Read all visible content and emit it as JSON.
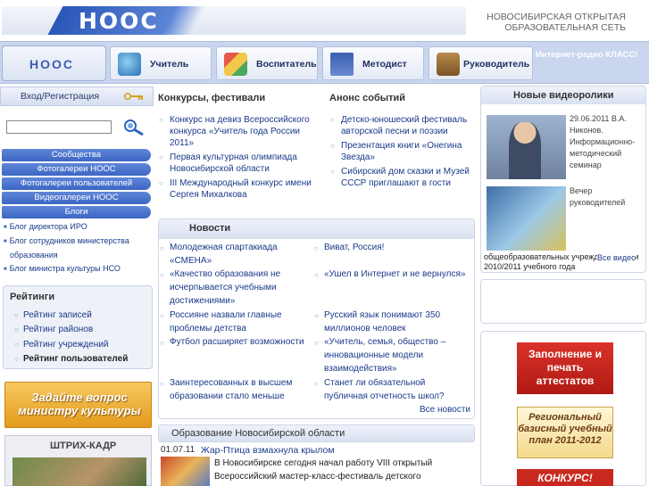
{
  "header": {
    "logo": "НООС",
    "network_name_line1": "НОВОСИБИРСКАЯ ОТКРЫТАЯ",
    "network_name_line2": "ОБРАЗОВАТЕЛЬНАЯ СЕТЬ"
  },
  "topnav": {
    "home": "НООС",
    "items": [
      {
        "label": "Учитель",
        "icon": "globe-icon"
      },
      {
        "label": "Воспитатель",
        "icon": "abc-blocks-icon"
      },
      {
        "label": "Методист",
        "icon": "book-icon"
      },
      {
        "label": "Руководитель",
        "icon": "briefcase-icon"
      }
    ],
    "radio": "Интернет-радио КЛАСС!"
  },
  "sidebar": {
    "login": "Вход/Регистрация",
    "menu": [
      "Сообщества",
      "Фотогалереи НООС",
      "Фотогалереи пользователей",
      "Видеогалереи НООС",
      "Блоги"
    ],
    "blogs": [
      "Блог директора ИРО",
      "Блог сотрудников министерства",
      "образования",
      "Блог министра культуры НСО"
    ],
    "ratings_title": "Рейтинги",
    "ratings": [
      "Рейтинг записей",
      "Рейтинг районов",
      "Рейтинг учреждений",
      "Рейтинг пользователей"
    ],
    "minister_banner": "Задайте вопрос министру культуры",
    "strih_title": "ШТРИХ-КАДР"
  },
  "contests": {
    "title": "Конкурсы, фестивали",
    "items": [
      "Конкурс на девиз Всероссийского конкурса «Учитель года России 2011»",
      "Первая культурная олимпиада Новосибирской области",
      "III Международный конкурс имени Сергея Михалкова"
    ]
  },
  "events": {
    "title": "Анонс событий",
    "items": [
      "Детско-юношеский фестиваль авторской песни и поэзии",
      "Презентация книги «Онегина Звезда»",
      "Сибирский дом сказки и Музей СССР приглашают в гости"
    ]
  },
  "news": {
    "title": "Новости",
    "left": [
      "Молодежная спартакиада «СМЕНА»",
      "«Качество образования не исчерпывается учебными достижениями»",
      "Россияне назвали главные проблемы детства",
      "Футбол расширяет возможности",
      "Заинтересованных в высшем образовании стало меньше"
    ],
    "right": [
      "Виват, Россия!",
      "«Ушел в Интернет и не вернулся»",
      "Русский язык понимают 350 миллионов человек",
      "«Учитель, семья, общество – инновационные модели взаимодействия»",
      "Станет ли обязательной публичная отчетность школ?"
    ],
    "all": "Все новости"
  },
  "education": {
    "title": "Образование Новосибирской области",
    "date": "01.07.11",
    "headline": "Жар-Птица взмахнула крылом",
    "text": "В Новосибирске сегодня начал работу VIII открытый Всероссийский мастер-класс-фестиваль детского"
  },
  "videos": {
    "title": "Новые видеоролики",
    "v1": "29.06.2011 В.А. Никонов. Информационно-методический семинар",
    "v2": "Вечер руководителей",
    "v2_sub": "общеобразовательных учреждений итоги 2010/2011 учебного года",
    "all": "Все видео"
  },
  "banners": {
    "attestats": "Заполнение и печать аттестатов",
    "plan": "Региональный базисный учебный план 2011-2012",
    "konkurs": "КОНКУРС!"
  }
}
